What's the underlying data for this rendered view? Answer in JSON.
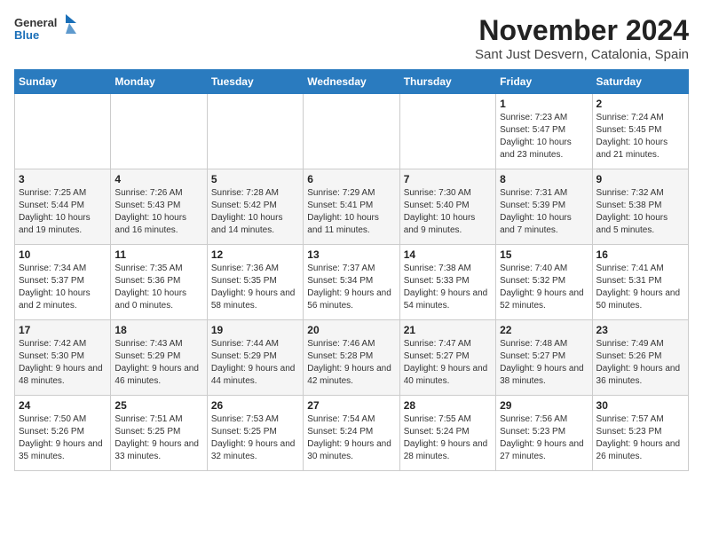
{
  "logo": {
    "general": "General",
    "blue": "Blue"
  },
  "header": {
    "month_title": "November 2024",
    "subtitle": "Sant Just Desvern, Catalonia, Spain"
  },
  "weekdays": [
    "Sunday",
    "Monday",
    "Tuesday",
    "Wednesday",
    "Thursday",
    "Friday",
    "Saturday"
  ],
  "weeks": [
    [
      {
        "day": "",
        "info": ""
      },
      {
        "day": "",
        "info": ""
      },
      {
        "day": "",
        "info": ""
      },
      {
        "day": "",
        "info": ""
      },
      {
        "day": "",
        "info": ""
      },
      {
        "day": "1",
        "info": "Sunrise: 7:23 AM\nSunset: 5:47 PM\nDaylight: 10 hours and 23 minutes."
      },
      {
        "day": "2",
        "info": "Sunrise: 7:24 AM\nSunset: 5:45 PM\nDaylight: 10 hours and 21 minutes."
      }
    ],
    [
      {
        "day": "3",
        "info": "Sunrise: 7:25 AM\nSunset: 5:44 PM\nDaylight: 10 hours and 19 minutes."
      },
      {
        "day": "4",
        "info": "Sunrise: 7:26 AM\nSunset: 5:43 PM\nDaylight: 10 hours and 16 minutes."
      },
      {
        "day": "5",
        "info": "Sunrise: 7:28 AM\nSunset: 5:42 PM\nDaylight: 10 hours and 14 minutes."
      },
      {
        "day": "6",
        "info": "Sunrise: 7:29 AM\nSunset: 5:41 PM\nDaylight: 10 hours and 11 minutes."
      },
      {
        "day": "7",
        "info": "Sunrise: 7:30 AM\nSunset: 5:40 PM\nDaylight: 10 hours and 9 minutes."
      },
      {
        "day": "8",
        "info": "Sunrise: 7:31 AM\nSunset: 5:39 PM\nDaylight: 10 hours and 7 minutes."
      },
      {
        "day": "9",
        "info": "Sunrise: 7:32 AM\nSunset: 5:38 PM\nDaylight: 10 hours and 5 minutes."
      }
    ],
    [
      {
        "day": "10",
        "info": "Sunrise: 7:34 AM\nSunset: 5:37 PM\nDaylight: 10 hours and 2 minutes."
      },
      {
        "day": "11",
        "info": "Sunrise: 7:35 AM\nSunset: 5:36 PM\nDaylight: 10 hours and 0 minutes."
      },
      {
        "day": "12",
        "info": "Sunrise: 7:36 AM\nSunset: 5:35 PM\nDaylight: 9 hours and 58 minutes."
      },
      {
        "day": "13",
        "info": "Sunrise: 7:37 AM\nSunset: 5:34 PM\nDaylight: 9 hours and 56 minutes."
      },
      {
        "day": "14",
        "info": "Sunrise: 7:38 AM\nSunset: 5:33 PM\nDaylight: 9 hours and 54 minutes."
      },
      {
        "day": "15",
        "info": "Sunrise: 7:40 AM\nSunset: 5:32 PM\nDaylight: 9 hours and 52 minutes."
      },
      {
        "day": "16",
        "info": "Sunrise: 7:41 AM\nSunset: 5:31 PM\nDaylight: 9 hours and 50 minutes."
      }
    ],
    [
      {
        "day": "17",
        "info": "Sunrise: 7:42 AM\nSunset: 5:30 PM\nDaylight: 9 hours and 48 minutes."
      },
      {
        "day": "18",
        "info": "Sunrise: 7:43 AM\nSunset: 5:29 PM\nDaylight: 9 hours and 46 minutes."
      },
      {
        "day": "19",
        "info": "Sunrise: 7:44 AM\nSunset: 5:29 PM\nDaylight: 9 hours and 44 minutes."
      },
      {
        "day": "20",
        "info": "Sunrise: 7:46 AM\nSunset: 5:28 PM\nDaylight: 9 hours and 42 minutes."
      },
      {
        "day": "21",
        "info": "Sunrise: 7:47 AM\nSunset: 5:27 PM\nDaylight: 9 hours and 40 minutes."
      },
      {
        "day": "22",
        "info": "Sunrise: 7:48 AM\nSunset: 5:27 PM\nDaylight: 9 hours and 38 minutes."
      },
      {
        "day": "23",
        "info": "Sunrise: 7:49 AM\nSunset: 5:26 PM\nDaylight: 9 hours and 36 minutes."
      }
    ],
    [
      {
        "day": "24",
        "info": "Sunrise: 7:50 AM\nSunset: 5:26 PM\nDaylight: 9 hours and 35 minutes."
      },
      {
        "day": "25",
        "info": "Sunrise: 7:51 AM\nSunset: 5:25 PM\nDaylight: 9 hours and 33 minutes."
      },
      {
        "day": "26",
        "info": "Sunrise: 7:53 AM\nSunset: 5:25 PM\nDaylight: 9 hours and 32 minutes."
      },
      {
        "day": "27",
        "info": "Sunrise: 7:54 AM\nSunset: 5:24 PM\nDaylight: 9 hours and 30 minutes."
      },
      {
        "day": "28",
        "info": "Sunrise: 7:55 AM\nSunset: 5:24 PM\nDaylight: 9 hours and 28 minutes."
      },
      {
        "day": "29",
        "info": "Sunrise: 7:56 AM\nSunset: 5:23 PM\nDaylight: 9 hours and 27 minutes."
      },
      {
        "day": "30",
        "info": "Sunrise: 7:57 AM\nSunset: 5:23 PM\nDaylight: 9 hours and 26 minutes."
      }
    ]
  ]
}
